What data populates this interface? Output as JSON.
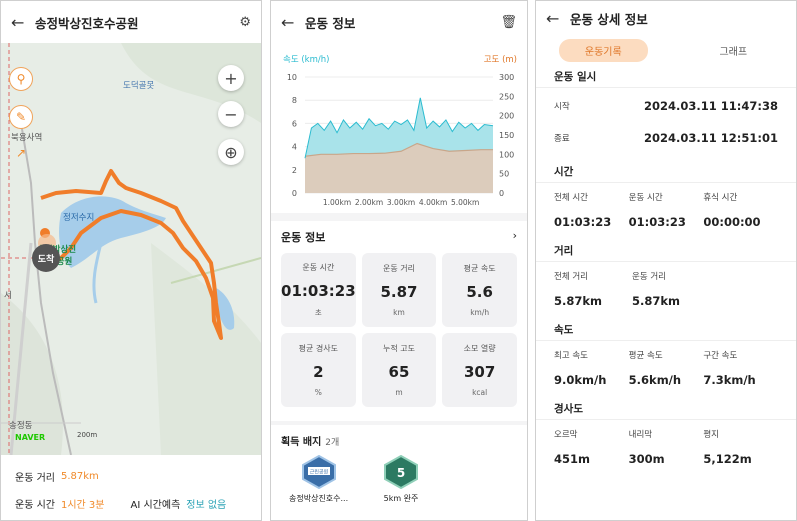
{
  "panel1": {
    "title": "송정박상진호수공원",
    "map_labels": {
      "dodeok": "도덕골못",
      "bokyongsaeok": "북용사역",
      "reservoir": "정저수지",
      "park_line1": "송정박상진",
      "park_line2": "호수공원",
      "songjeong": "송정동",
      "road": "서"
    },
    "arrival": "도착",
    "naver": "NAVER",
    "scale": "200m",
    "distance_label": "운동 거리",
    "distance_value": "5.87km",
    "time_label": "운동 시간",
    "time_value": "1시간 3분",
    "ai_label": "AI 시간예측",
    "ai_value": "정보 없음"
  },
  "panel2": {
    "title": "운동 정보",
    "chart_data": {
      "type": "area",
      "left_axis_label": "속도 (km/h)",
      "right_axis_label": "고도 (m)",
      "left_ticks": [
        "10",
        "8",
        "6",
        "4",
        "2",
        "0"
      ],
      "right_ticks": [
        "300",
        "250",
        "200",
        "150",
        "100",
        "50",
        "0"
      ],
      "x_ticks": [
        "1.00km",
        "2.00km",
        "3.00km",
        "4.00km",
        "5.00km"
      ],
      "speed_ylim": [
        0,
        10
      ],
      "alt_ylim": [
        0,
        300
      ],
      "xlim": [
        0,
        5.87
      ],
      "series": [
        {
          "name": "속도 (km/h)",
          "x": [
            0,
            0.2,
            0.4,
            0.6,
            0.8,
            1.0,
            1.2,
            1.4,
            1.6,
            1.8,
            2.0,
            2.2,
            2.4,
            2.6,
            2.8,
            3.0,
            3.2,
            3.4,
            3.6,
            3.8,
            4.0,
            4.2,
            4.4,
            4.6,
            4.8,
            5.0,
            5.2,
            5.4,
            5.6,
            5.87
          ],
          "values": [
            3.0,
            5.6,
            6.0,
            5.4,
            6.2,
            5.2,
            6.3,
            5.6,
            6.1,
            5.5,
            6.4,
            5.8,
            6.0,
            5.5,
            6.2,
            5.9,
            6.3,
            5.4,
            8.2,
            5.6,
            6.2,
            5.7,
            6.3,
            5.3,
            6.1,
            5.6,
            6.0,
            5.4,
            5.9,
            5.8
          ]
        },
        {
          "name": "고도 (m)",
          "x": [
            0,
            0.5,
            1.0,
            1.5,
            2.0,
            2.5,
            3.0,
            3.5,
            4.0,
            4.5,
            5.0,
            5.5,
            5.87
          ],
          "values": [
            95,
            100,
            100,
            102,
            102,
            103,
            108,
            128,
            115,
            108,
            110,
            112,
            112
          ]
        }
      ],
      "colors": {
        "speed": "#2bbcd0",
        "speed_fill": "#a9e3ea",
        "alt": "#c8a68a",
        "alt_fill": "#dcccbc"
      }
    },
    "info_title": "운동 정보",
    "cards": [
      {
        "title": "운동 시간",
        "value": "01:03:23",
        "unit": "초"
      },
      {
        "title": "운동 거리",
        "value": "5.87",
        "unit": "km"
      },
      {
        "title": "평균 속도",
        "value": "5.6",
        "unit": "km/h"
      },
      {
        "title": "평균 경사도",
        "value": "2",
        "unit": "%"
      },
      {
        "title": "누적 고도",
        "value": "65",
        "unit": "m"
      },
      {
        "title": "소모 열량",
        "value": "307",
        "unit": "kcal"
      }
    ],
    "badge_title": "획득 배지",
    "badge_count": "2개",
    "badges": [
      {
        "label": "송정박상진호수...",
        "emblem": "근린공원"
      },
      {
        "label": "5km 완주",
        "emblem": "5"
      }
    ]
  },
  "panel3": {
    "title": "운동 상세 정보",
    "tab_active": "운동기록",
    "tab_inactive": "그래프",
    "datetime_section": "운동 일시",
    "start_label": "시작",
    "start_value": "2024.03.11 11:47:38",
    "end_label": "종료",
    "end_value": "2024.03.11 12:51:01",
    "time_section": "시간",
    "time_items": [
      {
        "k": "전체 시간",
        "v": "01:03:23"
      },
      {
        "k": "운동 시간",
        "v": "01:03:23"
      },
      {
        "k": "휴식 시간",
        "v": "00:00:00"
      }
    ],
    "distance_section": "거리",
    "distance_items": [
      {
        "k": "전체 거리",
        "v": "5.87km"
      },
      {
        "k": "운동 거리",
        "v": "5.87km"
      }
    ],
    "speed_section": "속도",
    "speed_items": [
      {
        "k": "최고 속도",
        "v": "9.0km/h"
      },
      {
        "k": "평균 속도",
        "v": "5.6km/h"
      },
      {
        "k": "구간 속도",
        "v": "7.3km/h"
      }
    ],
    "slope_section": "경사도",
    "slope_items": [
      {
        "k": "오르막",
        "v": "451m"
      },
      {
        "k": "내리막",
        "v": "300m"
      },
      {
        "k": "평지",
        "v": "5,122m"
      }
    ]
  }
}
